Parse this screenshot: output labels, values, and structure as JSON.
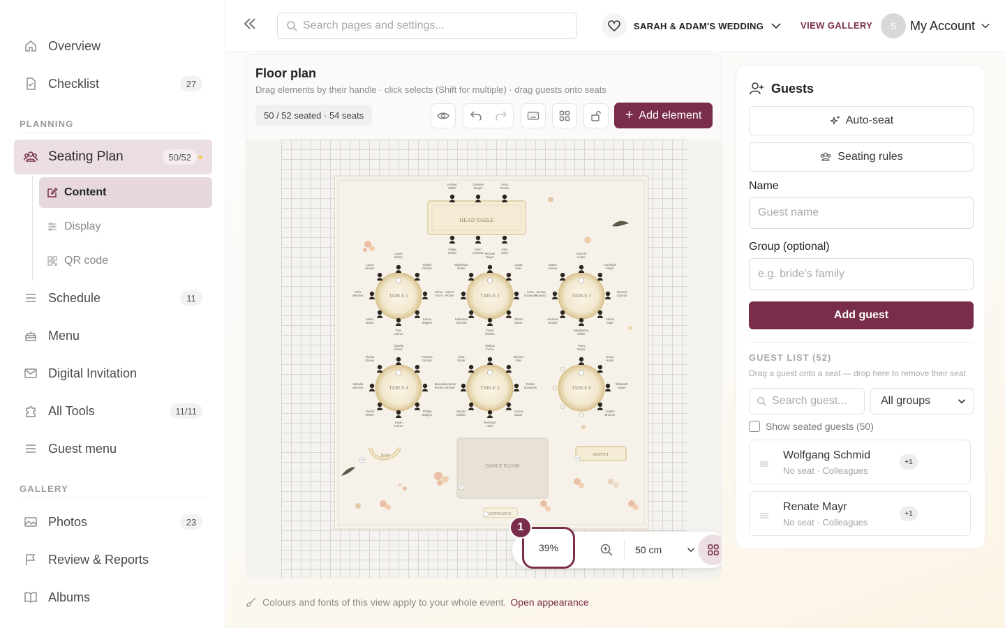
{
  "sidebar": {
    "items": [
      {
        "label": "Overview",
        "icon": "home-icon"
      },
      {
        "label": "Checklist",
        "icon": "checklist-icon",
        "count": "27"
      },
      {
        "label": "Seating Plan",
        "icon": "people-icon",
        "count": "50/52",
        "active": true
      },
      {
        "label": "Schedule",
        "icon": "schedule-icon",
        "count": "11"
      },
      {
        "label": "Menu",
        "icon": "cake-icon"
      },
      {
        "label": "Digital Invitation",
        "icon": "mail-icon"
      },
      {
        "label": "All Tools",
        "icon": "puzzle-icon",
        "count": "11/11"
      },
      {
        "label": "Guest menu",
        "icon": "menu-lines-icon"
      },
      {
        "label": "Photos",
        "icon": "photo-icon",
        "count": "23"
      },
      {
        "label": "Review & Reports",
        "icon": "flag-icon"
      },
      {
        "label": "Albums",
        "icon": "book-icon"
      }
    ],
    "sub_items": [
      {
        "label": "Content",
        "icon": "edit-icon",
        "active": true
      },
      {
        "label": "Display",
        "icon": "sliders-icon"
      },
      {
        "label": "QR code",
        "icon": "qr-icon"
      }
    ],
    "sections": {
      "planning": "PLANNING",
      "gallery": "GALLERY"
    }
  },
  "topbar": {
    "search_placeholder": "Search pages and settings...",
    "event_name": "SARAH & ADAM'S WEDDING",
    "view_gallery": "VIEW GALLERY",
    "avatar_initial": "S",
    "account_label": "My Account"
  },
  "floor_plan": {
    "title": "Floor plan",
    "subtitle": "Drag elements by their handle · click selects (Shift for multiple) · drag guests onto seats",
    "stats": "50 / 52 seated · 54 seats",
    "add_element": "Add element",
    "zoom": "39%",
    "zoom_badge": "1",
    "grid_size": "50 cm",
    "labels": {
      "head_table": "HEAD TABLE",
      "tables": [
        "TABLE 1",
        "TABLE 2",
        "TABLE 3",
        "TABLE 4",
        "TABLE 5",
        "TABLE 6"
      ],
      "dance_floor": "DANCE FLOOR",
      "bar": "BAR",
      "buffet": "BUFFET",
      "entrance": "ENTRANCE"
    },
    "head_table_guests_top": [
      "Herbert Müller",
      "Gerlinde Berger",
      "Anna Gruber"
    ],
    "head_table_guests_bottom": [
      "Helga Gruber",
      "Franz Schwarz",
      "John Hofer"
    ],
    "table_guests": [
      [
        "Lukas Moser",
        "Sophie Fischer",
        "Elena Fuchs",
        "Emma Wagner",
        "Paul Leitner",
        "Marie Weber",
        "Felix Wimmer",
        "Laura Steiner"
      ],
      [
        "Michael Mayer",
        "Jonas Eder",
        "Lena Schneider",
        "Tobias Bauer",
        "David Winkler",
        "Katharina Schmidt",
        "Simon Pichler",
        "Maximilian Reiter"
      ],
      [
        "Hannah Huber",
        "Christoph Mayer",
        "Theresa Schmid",
        "Stefan Mayr",
        "Magdalena Müller",
        "Andreas Berger",
        "Verena Schwarz",
        "Martin Gruber"
      ],
      [
        "Claudia Moser",
        "Thomas Fischer",
        "Bianca Pichler",
        "Philipp Wagner",
        "Sarah Leitner",
        "Daniel Weber",
        "Isabella Wimmer",
        "Florian Steiner"
      ],
      [
        "Markus Fuchs",
        "Melanie Eder",
        "Patrick Schneider",
        "Carina Bauer",
        "Bernhard Hofer",
        "Sandra Winkler",
        "Alexander Schmidt",
        "Nina Reiter"
      ],
      [
        "Petra Mayer",
        "Georg Huber",
        "Elisabeth Mayer",
        "Sophie Brunner"
      ]
    ],
    "footnote": "Colours and fonts of this view apply to your whole event.",
    "footnote_link": "Open appearance"
  },
  "guests": {
    "title": "Guests",
    "auto_seat": "Auto-seat",
    "seating_rules": "Seating rules",
    "name_label": "Name",
    "name_placeholder": "Guest name",
    "group_label": "Group (optional)",
    "group_placeholder": "e.g. bride's family",
    "add_guest": "Add guest",
    "list_head": "GUEST LIST (52)",
    "list_sub": "Drag a guest onto a seat — drop here to remove their seat",
    "search_placeholder": "Search guest...",
    "group_filter": "All groups",
    "show_seated": "Show seated guests (50)",
    "list": [
      {
        "name": "Wolfgang Schmid",
        "meta": "No seat · Colleagues",
        "plus": "+1"
      },
      {
        "name": "Renate Mayr",
        "meta": "No seat · Colleagues",
        "plus": "+1"
      }
    ]
  },
  "colors": {
    "accent": "#7a2d4a",
    "accent_soft": "#ecdfe4",
    "table_gold": "#d8c28f",
    "floral": "#e9b79a"
  }
}
